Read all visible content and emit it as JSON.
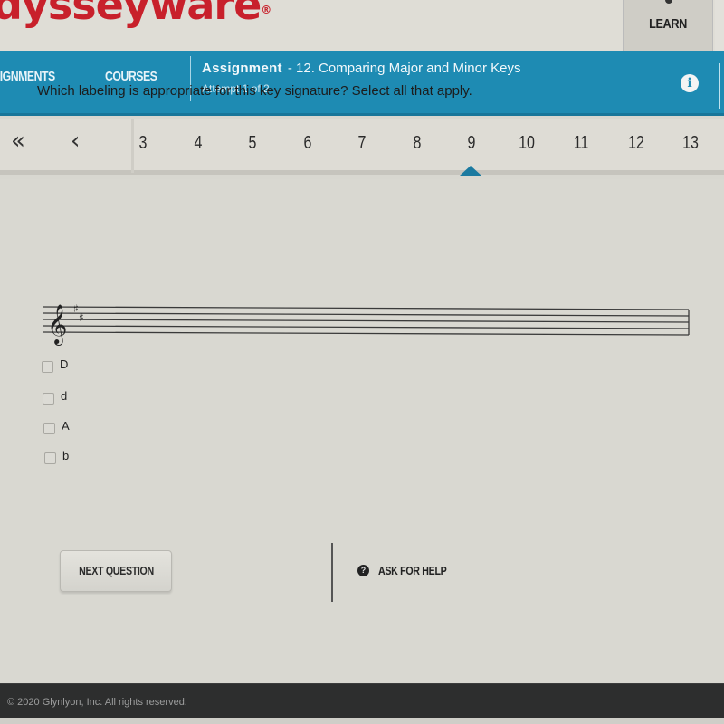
{
  "brand": {
    "logo_text": "dysseyware",
    "trademark": "®",
    "logo_color": "#c8202b"
  },
  "header": {
    "learn_tab": "LEARN"
  },
  "nav": {
    "items": [
      {
        "label": "ASSIGNMENTS",
        "display": "SIGNMENTS"
      },
      {
        "label": "COURSES"
      }
    ],
    "assignment_label": "Assignment",
    "assignment_title": "- 12. Comparing Major and Minor Keys",
    "attempt": "Attempt 1 of 2",
    "info_icon": "i",
    "accent_color": "#1e8bb3"
  },
  "question_nav": {
    "first_icon": "«",
    "prev_icon": "‹",
    "numbers": [
      "3",
      "4",
      "5",
      "6",
      "7",
      "8",
      "9",
      "10",
      "11",
      "12",
      "13"
    ],
    "current": "9"
  },
  "question": {
    "prompt": "Which labeling is appropriate for this key signature? Select all that apply.",
    "key_signature": "2 sharps (F#, C#) in treble clef",
    "options": [
      {
        "label": "D",
        "checked": false
      },
      {
        "label": "d",
        "checked": false
      },
      {
        "label": "A",
        "checked": false
      },
      {
        "label": "b",
        "checked": false
      }
    ]
  },
  "actions": {
    "next_question": "NEXT QUESTION",
    "ask_for_help": "ASK FOR HELP",
    "help_icon": "?"
  },
  "footer": {
    "copyright": "© 2020 Glynlyon, Inc. All rights reserved."
  }
}
